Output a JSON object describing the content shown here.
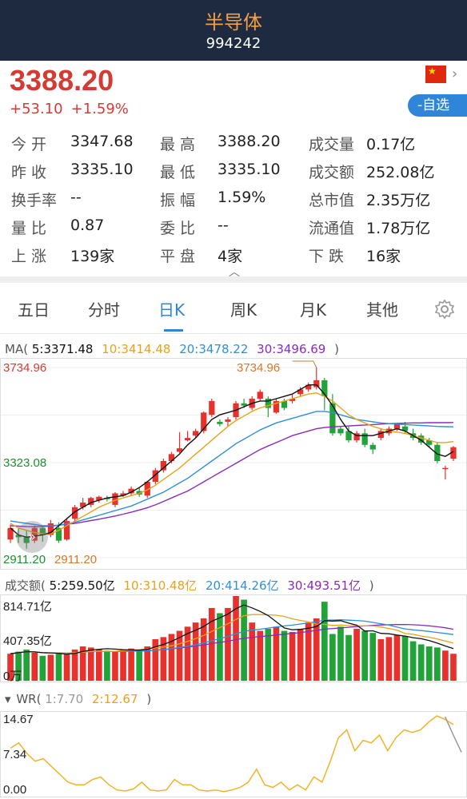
{
  "header": {
    "title": "半导体",
    "code": "994242"
  },
  "quote": {
    "price": "3388.20",
    "change": "+53.10",
    "change_pct": "+1.59%",
    "fav_label": "-自选",
    "flag": "cn-flag-icon"
  },
  "stats": [
    [
      {
        "label": "今 开",
        "value": "3347.68"
      },
      {
        "label": "最 高",
        "value": "3388.20"
      },
      {
        "label": "成交量",
        "value": "0.17亿"
      }
    ],
    [
      {
        "label": "昨 收",
        "value": "3335.10"
      },
      {
        "label": "最 低",
        "value": "3335.10"
      },
      {
        "label": "成交额",
        "value": "252.08亿"
      }
    ],
    [
      {
        "label": "换手率",
        "value": "--"
      },
      {
        "label": "振 幅",
        "value": "1.59%"
      },
      {
        "label": "总市值",
        "value": "2.35万亿"
      }
    ],
    [
      {
        "label": "量 比",
        "value": "0.87"
      },
      {
        "label": "委 比",
        "value": "--"
      },
      {
        "label": "流通值",
        "value": "1.78万亿"
      }
    ],
    [
      {
        "label": "上 涨",
        "value": "139家"
      },
      {
        "label": "平 盘",
        "value": "4家"
      },
      {
        "label": "下 跌",
        "value": "16家"
      }
    ]
  ],
  "tabs": [
    "五日",
    "分时",
    "日K",
    "周K",
    "月K",
    "其他"
  ],
  "active_tab": "日K",
  "colors": {
    "up": "#e8312c",
    "down": "#21a33a",
    "ma5": "#111111",
    "ma10": "#e8a21a",
    "ma20": "#2f8fd8",
    "ma30": "#8a2bbd",
    "accent": "#2f86d8"
  },
  "ma_legend": {
    "prefix": "MA(",
    "ma5": "5:3371.48",
    "ma10": "10:3414.48",
    "ma20": "20:3478.22",
    "ma30": "30:3496.69",
    "suffix": ")"
  },
  "vol_legend": {
    "prefix": "成交额(",
    "ma5": "5:259.50亿",
    "ma10": "10:310.48亿",
    "ma20": "20:414.26亿",
    "ma30": "30:493.51亿",
    "suffix": ")"
  },
  "wr_legend": {
    "prefix": "WR(",
    "w1": "1:7.70",
    "w2": "2:12.67",
    "suffix": ")"
  },
  "price_axis": {
    "top": "3734.96",
    "mid": "3323.08",
    "bottom": "2911.20",
    "max_marker": "3734.96",
    "min_marker": "2911.20"
  },
  "vol_axis": {
    "top": "814.71亿",
    "mid": "407.35亿",
    "bottom": "0万"
  },
  "wr_axis": {
    "top": "14.67",
    "mid": "7.34",
    "bottom": "0.00"
  },
  "chart_data": {
    "type": "candlestick",
    "ylim": [
      2911.2,
      3734.96
    ],
    "candles": [
      [
        2990,
        3040,
        2975,
        3055
      ],
      [
        3010,
        3000,
        2975,
        3040
      ],
      [
        3000,
        2975,
        2950,
        3030
      ],
      [
        2985,
        3040,
        2975,
        3050
      ],
      [
        3040,
        3010,
        2980,
        3050
      ],
      [
        3010,
        3060,
        3000,
        3075
      ],
      [
        3040,
        2985,
        2975,
        3065
      ],
      [
        2990,
        3070,
        2985,
        3080
      ],
      [
        3080,
        3130,
        3070,
        3140
      ],
      [
        3130,
        3150,
        3120,
        3170
      ],
      [
        3140,
        3170,
        3130,
        3175
      ],
      [
        3160,
        3175,
        3150,
        3180
      ],
      [
        3170,
        3165,
        3155,
        3180
      ],
      [
        3140,
        3190,
        3130,
        3195
      ],
      [
        3180,
        3190,
        3175,
        3200
      ],
      [
        3190,
        3210,
        3180,
        3220
      ],
      [
        3200,
        3185,
        3175,
        3215
      ],
      [
        3180,
        3240,
        3170,
        3245
      ],
      [
        3240,
        3290,
        3230,
        3300
      ],
      [
        3290,
        3330,
        3280,
        3340
      ],
      [
        3330,
        3360,
        3320,
        3370
      ],
      [
        3370,
        3385,
        3365,
        3455
      ],
      [
        3420,
        3430,
        3415,
        3460
      ],
      [
        3440,
        3460,
        3430,
        3470
      ],
      [
        3460,
        3540,
        3450,
        3545
      ],
      [
        3530,
        3590,
        3520,
        3600
      ],
      [
        3500,
        3490,
        3480,
        3510
      ],
      [
        3500,
        3510,
        3480,
        3520
      ],
      [
        3520,
        3580,
        3510,
        3590
      ],
      [
        3580,
        3570,
        3560,
        3600
      ],
      [
        3560,
        3600,
        3550,
        3610
      ],
      [
        3600,
        3630,
        3590,
        3640
      ],
      [
        3600,
        3560,
        3520,
        3610
      ],
      [
        3540,
        3590,
        3535,
        3600
      ],
      [
        3590,
        3560,
        3550,
        3600
      ],
      [
        3590,
        3600,
        3580,
        3620
      ],
      [
        3620,
        3640,
        3610,
        3650
      ],
      [
        3640,
        3660,
        3630,
        3670
      ],
      [
        3650,
        3680,
        3640,
        3734.96
      ],
      [
        3680,
        3610,
        3550,
        3690
      ],
      [
        3580,
        3450,
        3440,
        3620
      ],
      [
        3470,
        3450,
        3440,
        3480
      ],
      [
        3460,
        3420,
        3410,
        3480
      ],
      [
        3420,
        3450,
        3410,
        3460
      ],
      [
        3450,
        3400,
        3390,
        3470
      ],
      [
        3400,
        3380,
        3360,
        3410
      ],
      [
        3430,
        3460,
        3420,
        3470
      ],
      [
        3450,
        3470,
        3440,
        3480
      ],
      [
        3470,
        3490,
        3460,
        3495
      ],
      [
        3480,
        3460,
        3450,
        3500
      ],
      [
        3450,
        3430,
        3420,
        3470
      ],
      [
        3440,
        3410,
        3400,
        3450
      ],
      [
        3420,
        3400,
        3390,
        3430
      ],
      [
        3400,
        3330,
        3320,
        3410
      ],
      [
        3300,
        3300,
        3250,
        3310
      ],
      [
        3340,
        3390,
        3330,
        3395
      ]
    ],
    "volume": [
      260,
      280,
      300,
      270,
      240,
      250,
      260,
      265,
      300,
      330,
      320,
      300,
      290,
      280,
      300,
      310,
      290,
      330,
      400,
      420,
      450,
      480,
      520,
      560,
      600,
      700,
      650,
      700,
      814.71,
      780,
      560,
      480,
      500,
      520,
      480,
      470,
      500,
      560,
      600,
      760,
      450,
      520,
      440,
      500,
      480,
      460,
      400,
      420,
      440,
      430,
      380,
      350,
      330,
      320,
      290,
      259.5
    ],
    "ma5": [
      3040,
      3010,
      3000,
      3005,
      3010,
      3020,
      3050,
      3080,
      3110,
      3130,
      3150,
      3160,
      3170,
      3175,
      3180,
      3195,
      3215,
      3240,
      3270,
      3300,
      3330,
      3360,
      3400,
      3430,
      3470,
      3510,
      3530,
      3540,
      3550,
      3565,
      3580,
      3590,
      3590,
      3600,
      3610,
      3620,
      3640,
      3660,
      3660,
      3620,
      3570,
      3510,
      3460,
      3440,
      3440,
      3440,
      3450,
      3460,
      3470,
      3460,
      3440,
      3420,
      3390,
      3360,
      3350,
      3371.48
    ],
    "ma10": [
      3060,
      3040,
      3030,
      3020,
      3015,
      3015,
      3030,
      3050,
      3070,
      3090,
      3110,
      3130,
      3145,
      3160,
      3170,
      3180,
      3190,
      3205,
      3225,
      3250,
      3275,
      3300,
      3330,
      3360,
      3390,
      3420,
      3450,
      3480,
      3505,
      3525,
      3545,
      3560,
      3570,
      3580,
      3590,
      3600,
      3610,
      3620,
      3625,
      3610,
      3590,
      3560,
      3530,
      3510,
      3495,
      3480,
      3470,
      3460,
      3455,
      3450,
      3440,
      3430,
      3420,
      3410,
      3410,
      3414.48
    ],
    "ma20": [
      3070,
      3065,
      3060,
      3055,
      3050,
      3050,
      3052,
      3058,
      3065,
      3075,
      3085,
      3095,
      3105,
      3115,
      3125,
      3135,
      3150,
      3165,
      3180,
      3195,
      3215,
      3235,
      3255,
      3280,
      3305,
      3330,
      3355,
      3380,
      3405,
      3425,
      3445,
      3465,
      3480,
      3495,
      3505,
      3515,
      3525,
      3535,
      3545,
      3545,
      3540,
      3530,
      3520,
      3510,
      3505,
      3500,
      3495,
      3492,
      3490,
      3488,
      3486,
      3484,
      3482,
      3480,
      3479,
      3478.22
    ],
    "ma30": [
      3050,
      3048,
      3046,
      3045,
      3046,
      3048,
      3052,
      3056,
      3060,
      3066,
      3072,
      3078,
      3085,
      3092,
      3100,
      3108,
      3118,
      3128,
      3140,
      3155,
      3170,
      3185,
      3200,
      3220,
      3240,
      3260,
      3280,
      3300,
      3320,
      3340,
      3360,
      3380,
      3395,
      3410,
      3425,
      3440,
      3450,
      3460,
      3470,
      3475,
      3478,
      3480,
      3482,
      3484,
      3486,
      3488,
      3490,
      3492,
      3493,
      3494,
      3495,
      3495,
      3496,
      3496,
      3496,
      3496.69
    ],
    "wr_ylim": [
      0,
      14.67
    ],
    "wr2": [
      8.5,
      9.5,
      7.5,
      6,
      6.5,
      5,
      3.5,
      2,
      1.5,
      1.5,
      2.5,
      3,
      1.5,
      0.5,
      0.3,
      0.7,
      2,
      0.5,
      0.3,
      0.5,
      2.5,
      1.5,
      1.5,
      0.5,
      0.3,
      0.5,
      0.2,
      0.5,
      1,
      2,
      4.5,
      1.5,
      1,
      2,
      0.5,
      1.5,
      0.5,
      3,
      2,
      6,
      10.5,
      12,
      8,
      10,
      9.5,
      11,
      8,
      10.5,
      12,
      11.5,
      12,
      13.5,
      14.67,
      14,
      13
    ],
    "wr1": [
      null,
      null,
      null,
      null,
      null,
      null,
      null,
      null,
      null,
      null,
      null,
      null,
      null,
      null,
      null,
      null,
      null,
      null,
      null,
      null,
      null,
      null,
      null,
      null,
      null,
      null,
      null,
      null,
      null,
      null,
      null,
      null,
      null,
      null,
      null,
      null,
      null,
      null,
      null,
      null,
      null,
      null,
      null,
      null,
      null,
      null,
      null,
      null,
      null,
      null,
      null,
      null,
      null,
      14.5,
      11,
      7.7
    ]
  }
}
